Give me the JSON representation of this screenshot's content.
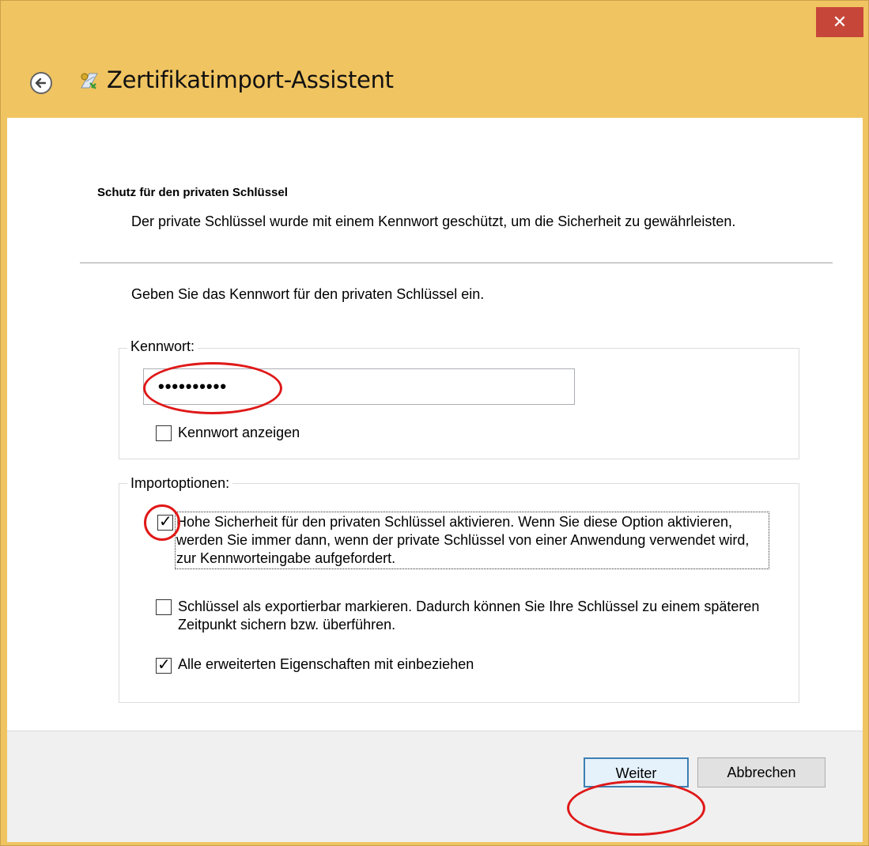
{
  "window": {
    "title": "Zertifikatimport-Assistent",
    "close_label": "✕"
  },
  "page": {
    "heading": "Schutz für den privaten Schlüssel",
    "description": "Der private Schlüssel wurde mit einem Kennwort geschützt, um die Sicherheit zu gewährleisten.",
    "instruction": "Geben Sie das Kennwort für den privaten Schlüssel ein."
  },
  "password_group": {
    "label": "Kennwort:",
    "value": "••••••••••",
    "show_password": {
      "label": "Kennwort anzeigen",
      "checked": false
    }
  },
  "import_options": {
    "label": "Importoptionen:",
    "options": [
      {
        "label": "Hohe Sicherheit für den privaten Schlüssel aktivieren. Wenn Sie diese Option aktivieren, werden Sie immer dann, wenn der private Schlüssel von einer Anwendung verwendet wird, zur Kennworteingabe aufgefordert.",
        "checked": true
      },
      {
        "label": "Schlüssel als exportierbar markieren. Dadurch können Sie Ihre Schlüssel zu einem späteren Zeitpunkt sichern bzw. überführen.",
        "checked": false
      },
      {
        "label": "Alle erweiterten Eigenschaften mit einbeziehen",
        "checked": true
      }
    ]
  },
  "buttons": {
    "next": "Weiter",
    "cancel": "Abbrechen"
  },
  "colors": {
    "titlebar": "#f0c461",
    "close": "#c7463a",
    "annotation": "#e01818"
  }
}
